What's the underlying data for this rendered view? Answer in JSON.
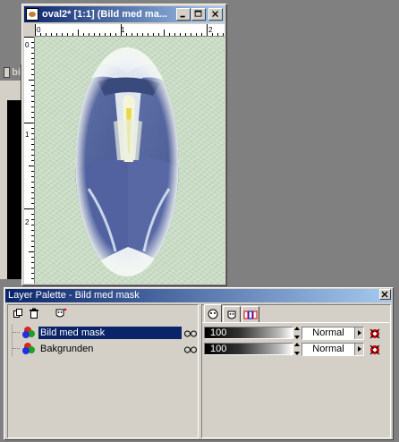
{
  "background_window": {
    "title": "bi"
  },
  "document_window": {
    "title": "oval2* [1:1] (Bild med ma...",
    "ruler_top_ticks": [
      "0",
      "1",
      "2"
    ],
    "ruler_left_ticks": [
      "0",
      "1",
      "2"
    ]
  },
  "layer_palette": {
    "title": "Layer Palette - Bild med mask",
    "layers": [
      {
        "name": "Bild med mask",
        "selected": true,
        "opacity": "100",
        "blend_mode": "Normal"
      },
      {
        "name": "Bakgrunden",
        "selected": false,
        "opacity": "100",
        "blend_mode": "Normal"
      }
    ]
  },
  "colors": {
    "title_active": "#0a246a",
    "title_gradient_end": "#a6caf0",
    "face": "#d4d0c8",
    "workspace": "#808080",
    "canvas": "#c8dcc4"
  }
}
